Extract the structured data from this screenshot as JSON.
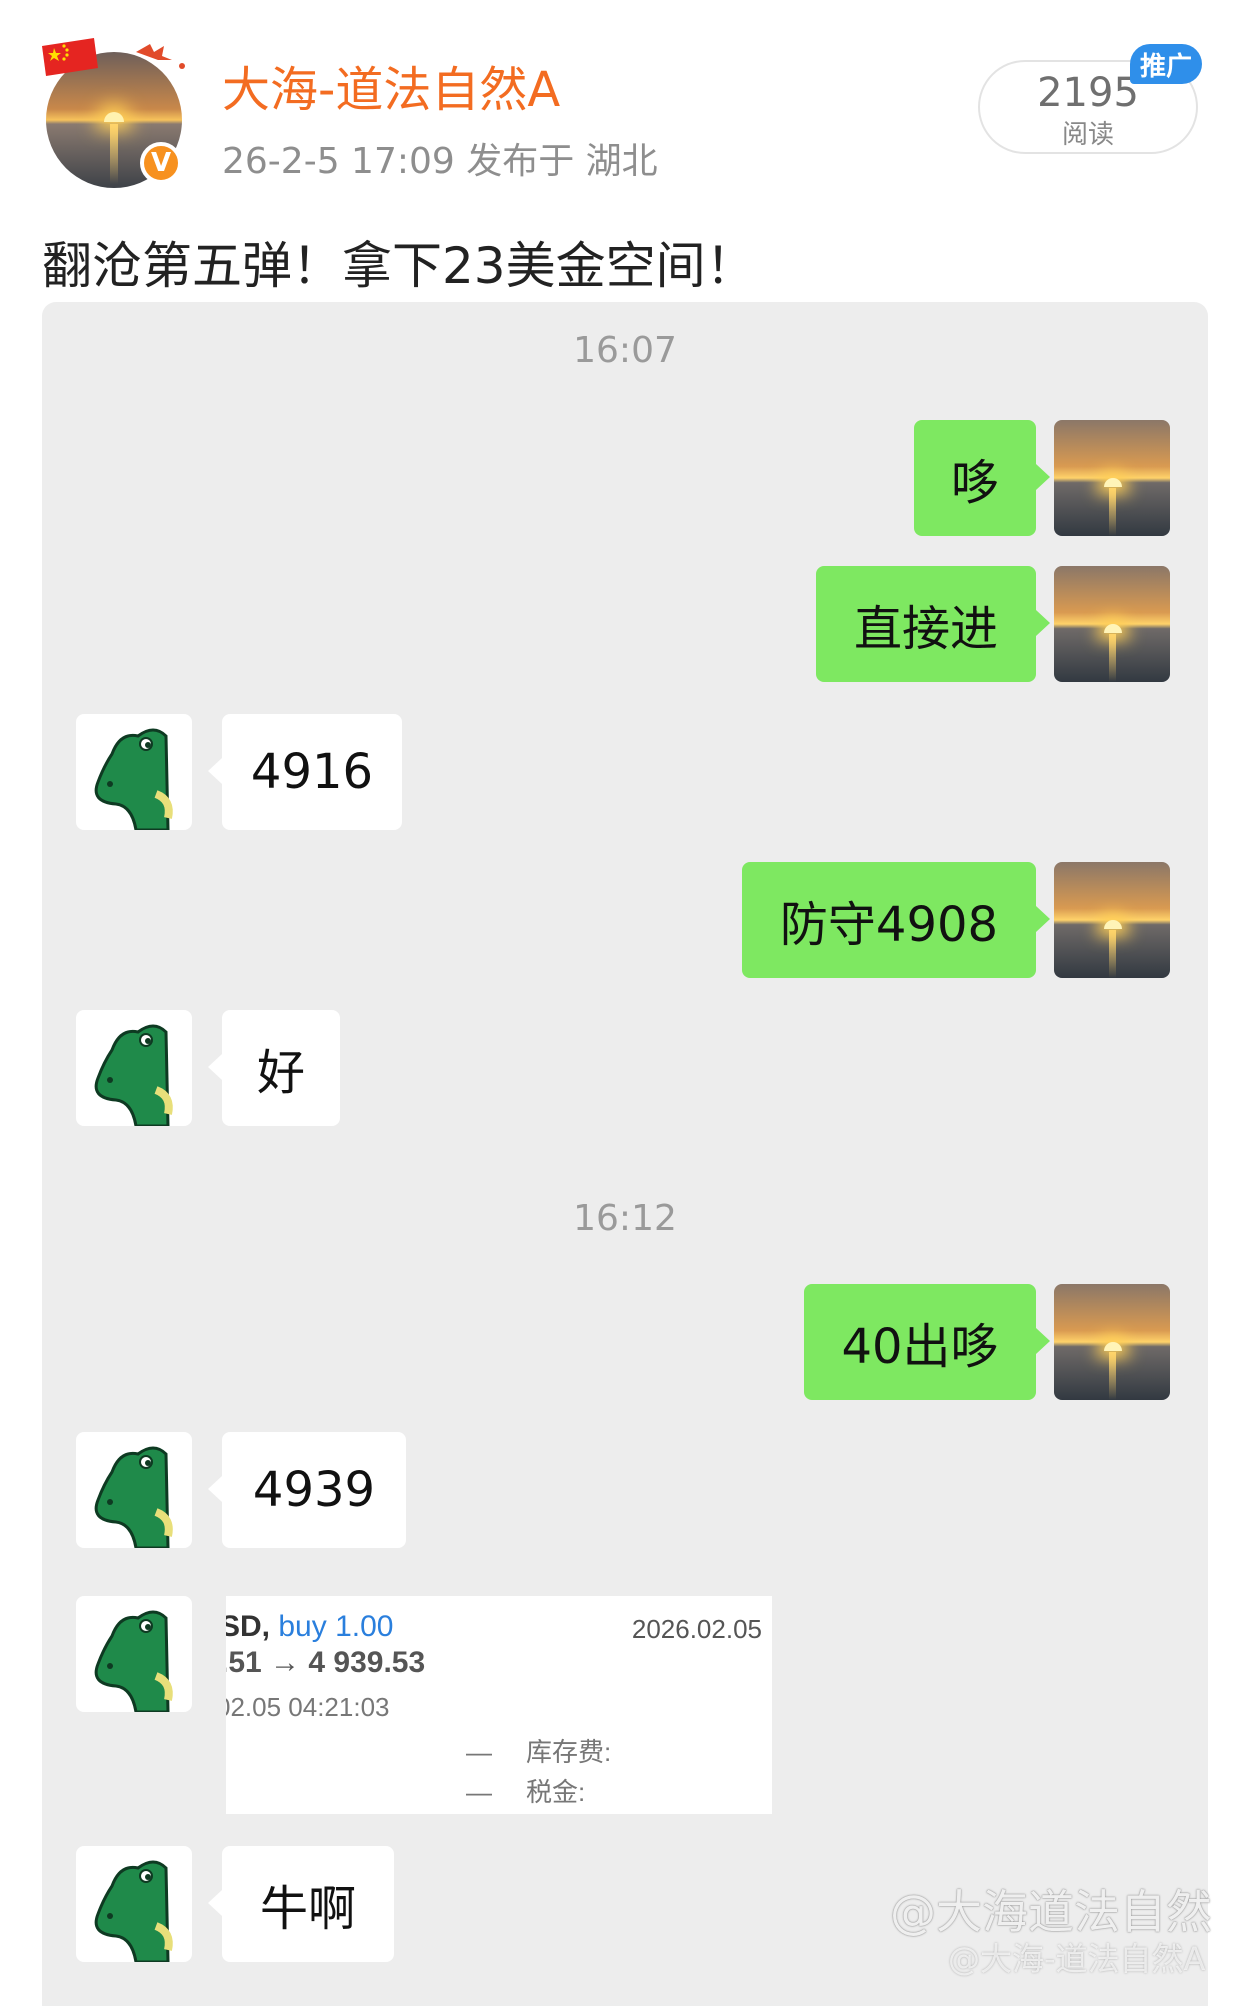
{
  "header": {
    "user_name": "大海-道法自然A",
    "post_meta": "26-2-5 17:09   发布于 湖北",
    "read_count": "2195",
    "read_label": "阅读",
    "promo_tag": "推广",
    "verify_badge": "V"
  },
  "post": {
    "text": "翻沧第五弹！拿下23美金空间！"
  },
  "chat": {
    "time_1": "16:07",
    "time_2": "16:12",
    "messages": [
      {
        "side": "out",
        "text": "哆"
      },
      {
        "side": "out",
        "text": "直接进"
      },
      {
        "side": "in",
        "text": "4916"
      },
      {
        "side": "out",
        "text": "防守4908"
      },
      {
        "side": "in",
        "text": "好"
      },
      {
        "side": "out",
        "text": "40出哆"
      },
      {
        "side": "in",
        "text": "4939"
      },
      {
        "side": "in",
        "text": "牛啊"
      }
    ],
    "trade_card": {
      "line1_symbol": "SD, ",
      "line1_action": "buy 1.00",
      "date": "2026.02.05",
      "line2": ".51 → 4 939.53",
      "line3": "02.05 04:21:03",
      "row1_label": "库存费:",
      "row2_label": "税金:",
      "dash": "—"
    }
  },
  "watermark": {
    "main": "@大海道法自然",
    "sub": "@大海-道法自然A"
  }
}
